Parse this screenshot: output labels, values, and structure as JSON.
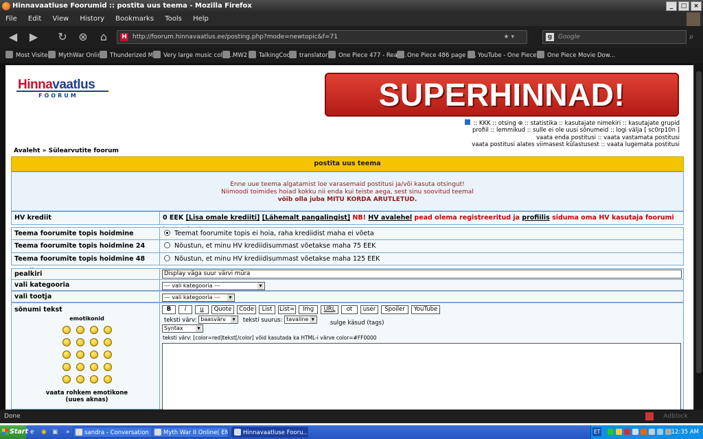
{
  "window": {
    "title": "Hinnavaatluse Foorumid :: postita uus teema - Mozilla Firefox"
  },
  "menubar": {
    "items": [
      "File",
      "Edit",
      "View",
      "History",
      "Bookmarks",
      "Tools",
      "Help"
    ]
  },
  "navbar": {
    "url": "http://foorum.hinnavaatlus.ee/posting.php?mode=newtopic&f=71",
    "search_placeholder": "Google"
  },
  "bookmarks": [
    "Most Visited",
    "MythWar Online",
    "Thunderized MW",
    "Very large music colle...",
    "MW2",
    "TalkingCock",
    "translator",
    "One Piece 477 - Read...",
    "One Piece 486 page c...",
    "YouTube - One Piece ...",
    "One Piece Movie Dow..."
  ],
  "logo": {
    "part1": "Hinna",
    "part2": "vaatlus",
    "sub": "FOORUM"
  },
  "banner": {
    "text": "SUPERHINNAD!"
  },
  "header_links": {
    "line1": ":: KKK  :: otsing ⊕  :: statistika  :: kasutajate nimekiri  :: kasutajate grupid",
    "line2": "profiil  :: lemmikud  :: sulle ei ole uusi sõnumeid  :: logi välja [ sc0rp10n ]",
    "line3": "vaata enda postitusi  :: vaata vastamata postitusi",
    "line4": "vaata postitusi alates viimasest külastusest  :: vaata lugemata postitusi"
  },
  "breadcrumb": {
    "home": "Avaleht",
    "sep": "»",
    "forum": "Sülearvutite foorum"
  },
  "form": {
    "header": "postita uus teema",
    "notice1": "Enne uue teema algatamist loe varasemaid postitusi ja/või kasuta otsingut!",
    "notice2": "Niimoodi toimides hoiad kokku nii enda kui teiste aega, sest sinu soovitud teemal",
    "notice3": "võib olla juba MITU KORDA ARUTLETUD.",
    "credit_label": "HV krediit",
    "credit_amount": "0 EEK",
    "credit_link1": "[Lisa omale krediiti]",
    "credit_link2": "[Lähemalt pangalingist]",
    "credit_nb": "NB!",
    "credit_link3": "HV avalehel",
    "credit_text1": "pead olema registreeritud ja",
    "credit_link4": "profiilis",
    "credit_text2": "siduma oma HV kasutaja foorumi kasutajanimega",
    "top_label": "Teema foorumite topis hoidmine",
    "top_option": "Teemat foorumite topis ei hoia, raha krediidist maha ei võeta",
    "top24_label": "Teema foorumite topis hoidmine 24 tundi",
    "top24_option": "Nõustun, et minu HV krediidisummast võetakse maha 75 EEK",
    "top48_label": "Teema foorumite topis hoidmine 48 tundi",
    "top48_option": "Nõustun, et minu HV krediidisummast võetakse maha 125 EEK",
    "subject_label": "pealkiri",
    "subject_value": "Display väga suur värvi müra",
    "category_label": "vali kategooria",
    "category_value": "--- vali kategooria ---",
    "maker_label": "vali tootja",
    "maker_value": "--- vali kategooria ---",
    "message_label": "sõnumi tekst",
    "emoticons_title": "emotikonid",
    "more_emoticons": "vaata rohkem emotikone (uues aknas)",
    "toolbar_buttons": [
      "B",
      "i",
      "u",
      "Quote",
      "Code",
      "List",
      "List=",
      "Img",
      "URL",
      "ot",
      "user",
      "Spoiler",
      "YouTube"
    ],
    "color_label": "teksti värv:",
    "color_value": "baasvärv",
    "size_label": "teksti suurus:",
    "size_value": "tavaline",
    "close_tags": "sulge käsud (tags)",
    "syntax_value": "Syntax",
    "hint": "teksti värv: [color=red]tekst[/color]  võid kasutada ka HTML-i värve color=#FF0000"
  },
  "statusbar": {
    "text": "Done",
    "adblock": "Adblock"
  },
  "taskbar": {
    "start": "Start",
    "tasks": [
      "sandra - Conversation",
      "Myth War II Online( ENG...",
      "Hinnavaatluse Fooru..."
    ],
    "lang": "ET",
    "clock": "12:35 AM"
  },
  "colors": {
    "accent": "#f5c400",
    "brand_red": "#c8102e",
    "brand_blue": "#1d3d8f",
    "notice_red": "#8b1a1a"
  }
}
